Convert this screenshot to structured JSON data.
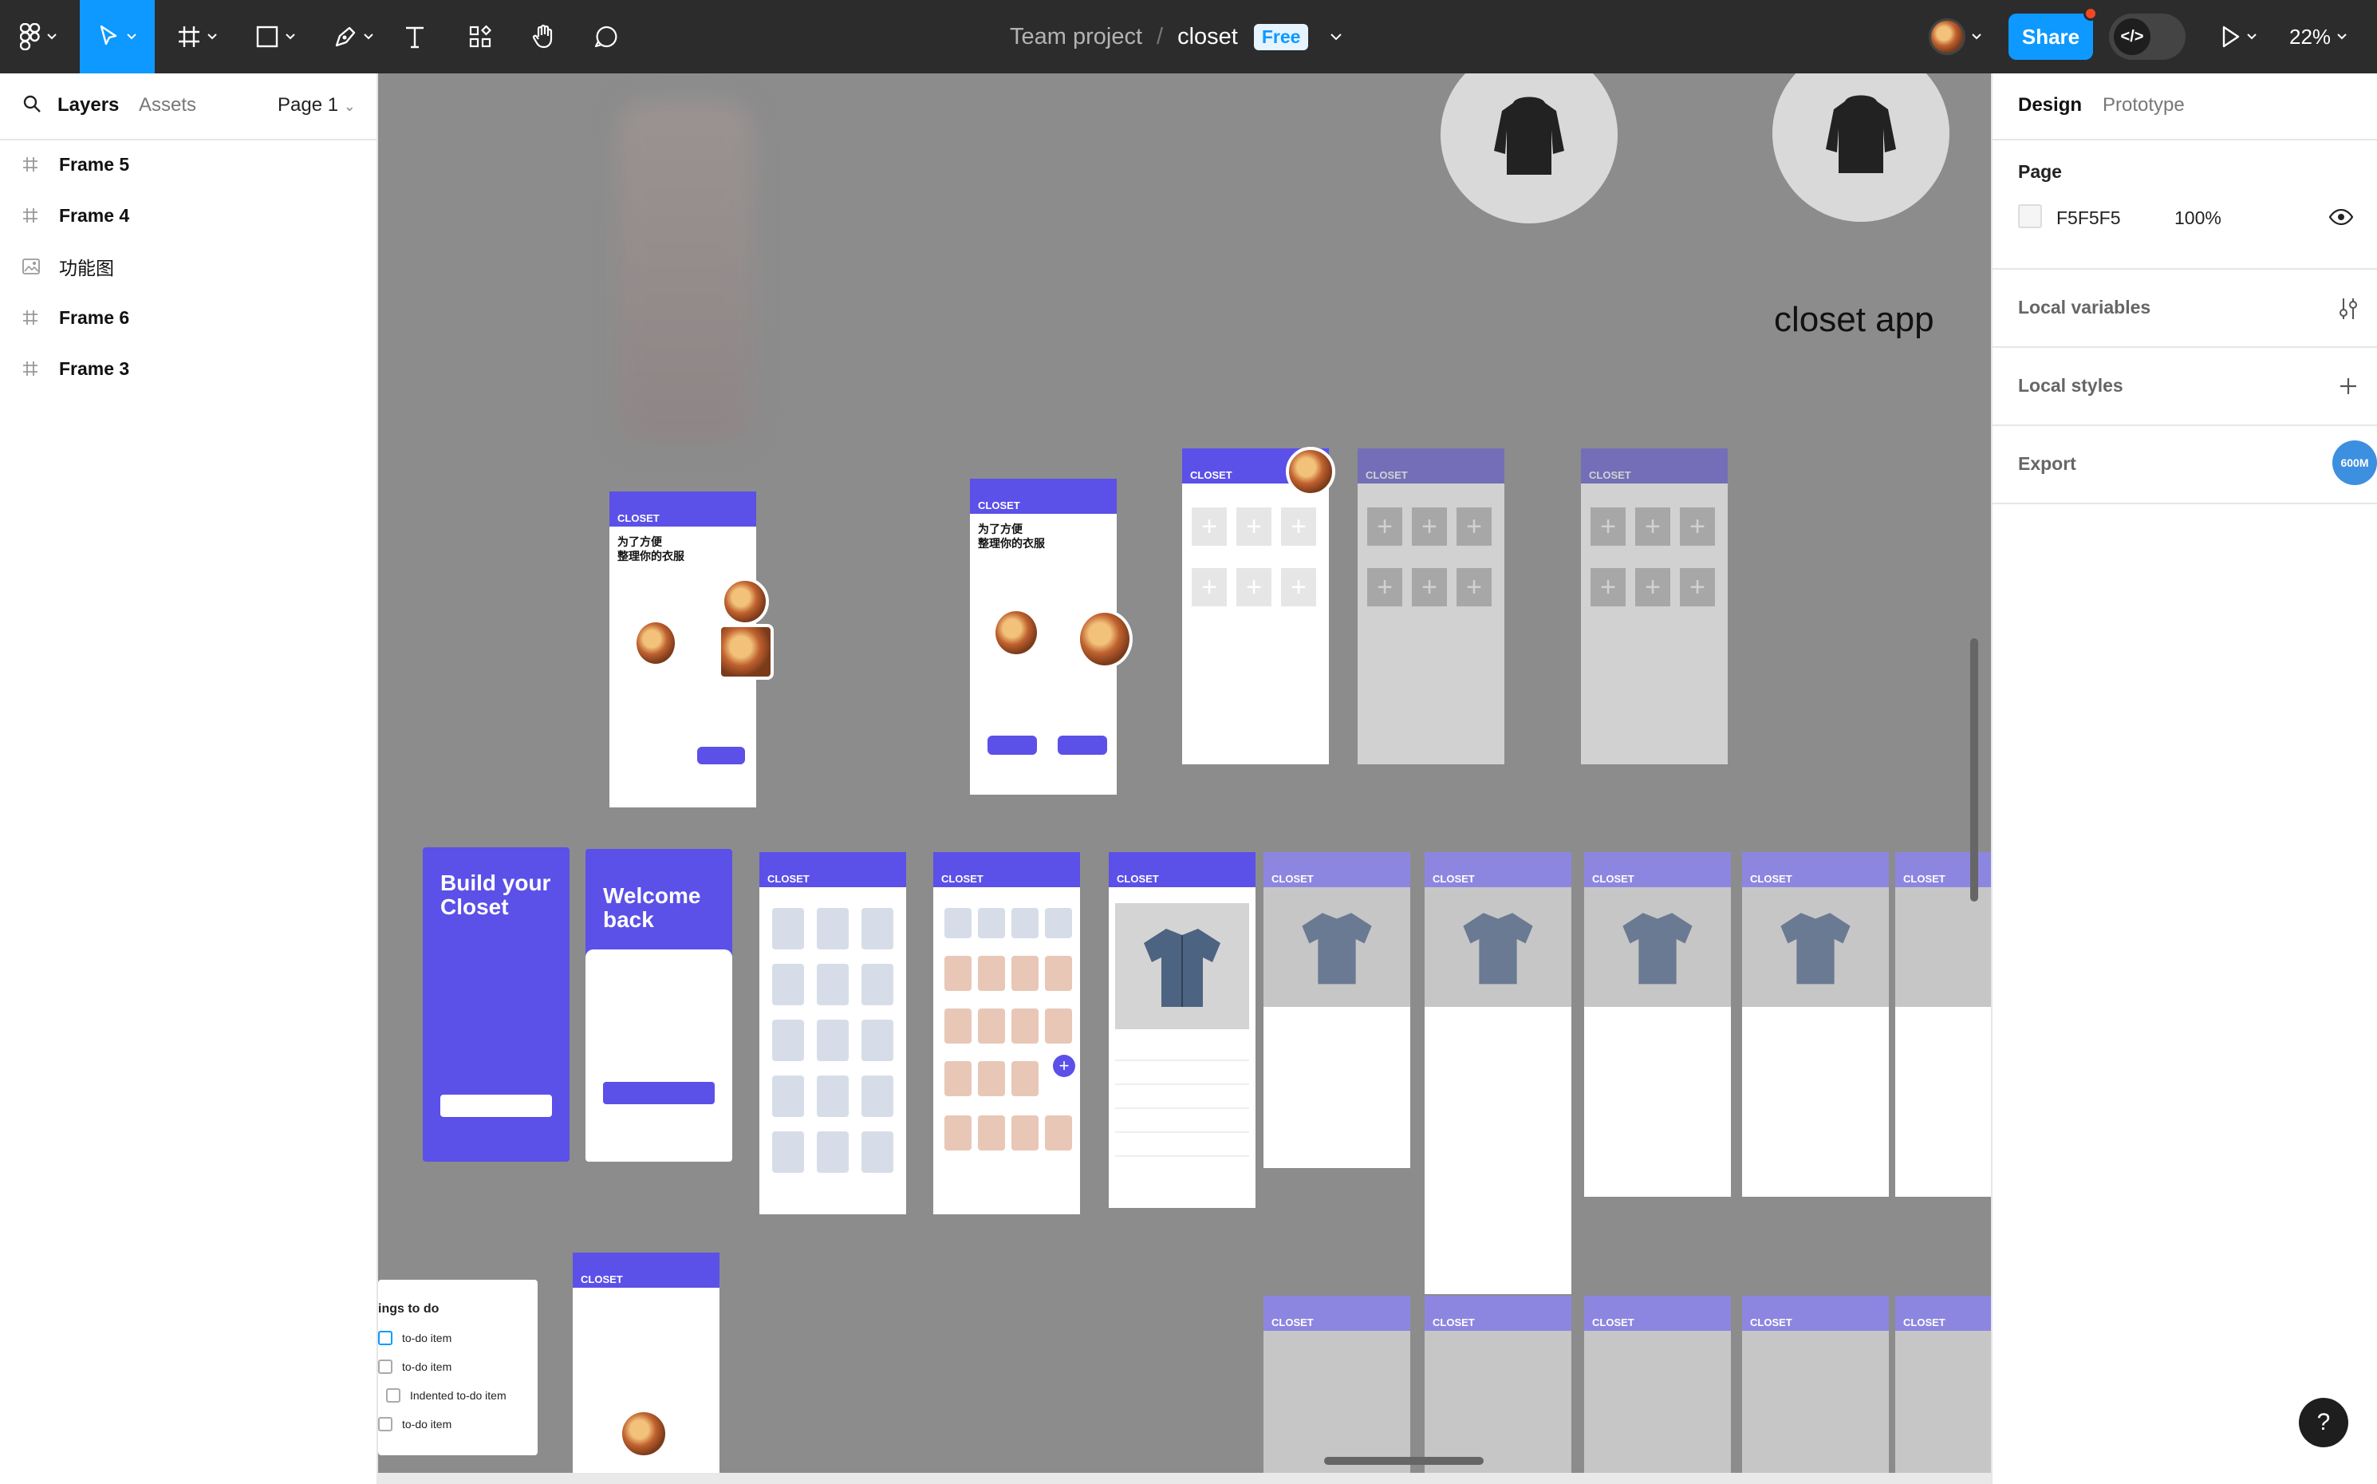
{
  "toolbar": {
    "doc_project": "Team project",
    "doc_separator": "/",
    "doc_file": "closet",
    "plan_badge": "Free",
    "share_label": "Share",
    "dev_mode_label": "</>",
    "zoom": "22%"
  },
  "left_panel": {
    "tabs": [
      "Layers",
      "Assets"
    ],
    "page_selector": "Page 1",
    "layers": [
      {
        "name": "Frame 5",
        "icon": "frame-icon"
      },
      {
        "name": "Frame 4",
        "icon": "frame-icon"
      },
      {
        "name": "功能图",
        "icon": "image-icon"
      },
      {
        "name": "Frame 6",
        "icon": "frame-icon"
      },
      {
        "name": "Frame 3",
        "icon": "frame-icon"
      }
    ]
  },
  "right_panel": {
    "tabs": [
      "Design",
      "Prototype"
    ],
    "page_section": "Page",
    "page_color": "F5F5F5",
    "page_opacity": "100%",
    "local_variables": "Local variables",
    "local_styles": "Local styles",
    "export": "Export"
  },
  "canvas": {
    "closet_app_label": "closet app",
    "frame_brand": "CLOSET",
    "headline": "为了方便\n整理你的衣服",
    "build_card": "Build your Closet",
    "welcome_card": "Welcome back",
    "todo_title": "ings to do",
    "todo_items": [
      "to-do item",
      "to-do item",
      "Indented to-do item",
      "to-do item"
    ]
  },
  "help_label": "?",
  "memory_badge": "600M",
  "colors": {
    "toolbar_bg": "#2c2c2c",
    "accent": "#0d99ff",
    "canvas_bg": "#8c8c8c",
    "app_purple": "#5b50e8"
  }
}
